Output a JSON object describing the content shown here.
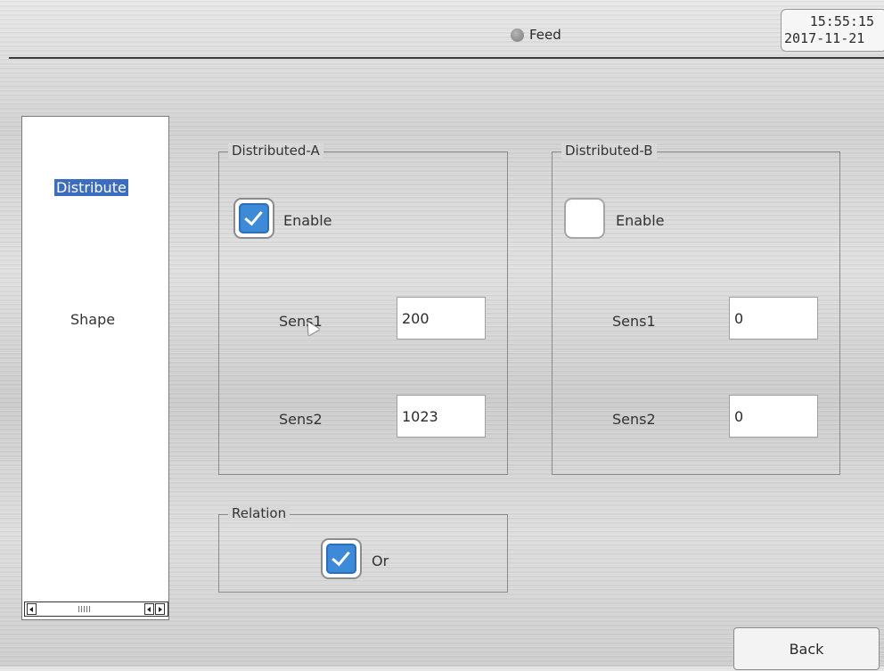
{
  "header": {
    "status_label": "Feed",
    "status_color": "#8a8a8a",
    "time": "15:55:15",
    "date": "2017-11-21"
  },
  "sidebar": {
    "items": [
      {
        "label": "Distribute",
        "selected": true
      },
      {
        "label": "Shape",
        "selected": false
      }
    ]
  },
  "groups": {
    "a": {
      "title": "Distributed-A",
      "enable_label": "Enable",
      "enabled": true,
      "sens1_label": "Sens1",
      "sens1_value": "200",
      "sens2_label": "Sens2",
      "sens2_value": "1023"
    },
    "b": {
      "title": "Distributed-B",
      "enable_label": "Enable",
      "enabled": false,
      "sens1_label": "Sens1",
      "sens1_value": "0",
      "sens2_label": "Sens2",
      "sens2_value": "0"
    },
    "relation": {
      "title": "Relation",
      "or_label": "Or",
      "or_checked": true
    }
  },
  "footer": {
    "back_label": "Back"
  },
  "colors": {
    "selection": "#3b6cc0",
    "checkbox_checked": "#3d8ad8"
  }
}
